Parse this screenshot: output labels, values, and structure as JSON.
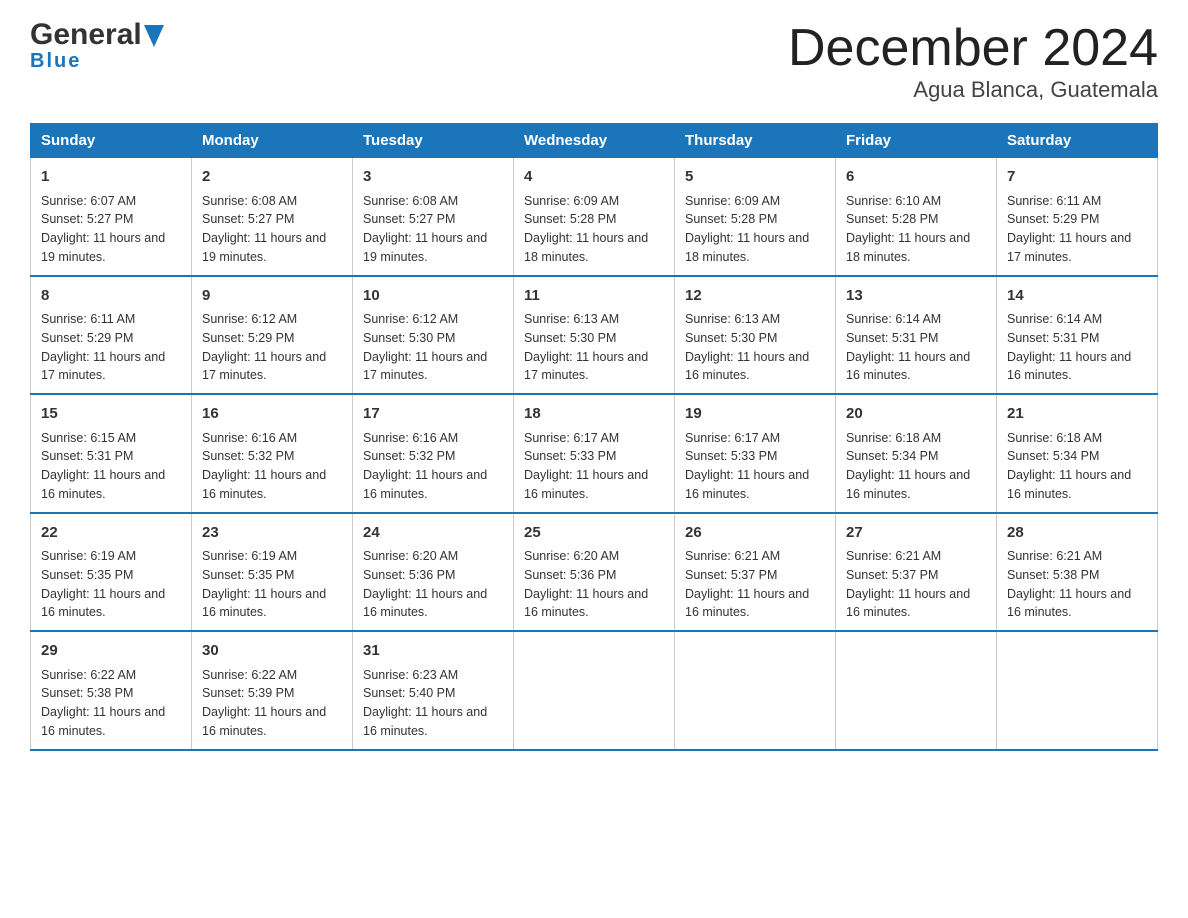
{
  "header": {
    "logo_line1": "General",
    "logo_line2": "Blue",
    "month": "December 2024",
    "location": "Agua Blanca, Guatemala"
  },
  "days_of_week": [
    "Sunday",
    "Monday",
    "Tuesday",
    "Wednesday",
    "Thursday",
    "Friday",
    "Saturday"
  ],
  "weeks": [
    [
      {
        "day": "1",
        "sunrise": "6:07 AM",
        "sunset": "5:27 PM",
        "daylight": "11 hours and 19 minutes."
      },
      {
        "day": "2",
        "sunrise": "6:08 AM",
        "sunset": "5:27 PM",
        "daylight": "11 hours and 19 minutes."
      },
      {
        "day": "3",
        "sunrise": "6:08 AM",
        "sunset": "5:27 PM",
        "daylight": "11 hours and 19 minutes."
      },
      {
        "day": "4",
        "sunrise": "6:09 AM",
        "sunset": "5:28 PM",
        "daylight": "11 hours and 18 minutes."
      },
      {
        "day": "5",
        "sunrise": "6:09 AM",
        "sunset": "5:28 PM",
        "daylight": "11 hours and 18 minutes."
      },
      {
        "day": "6",
        "sunrise": "6:10 AM",
        "sunset": "5:28 PM",
        "daylight": "11 hours and 18 minutes."
      },
      {
        "day": "7",
        "sunrise": "6:11 AM",
        "sunset": "5:29 PM",
        "daylight": "11 hours and 17 minutes."
      }
    ],
    [
      {
        "day": "8",
        "sunrise": "6:11 AM",
        "sunset": "5:29 PM",
        "daylight": "11 hours and 17 minutes."
      },
      {
        "day": "9",
        "sunrise": "6:12 AM",
        "sunset": "5:29 PM",
        "daylight": "11 hours and 17 minutes."
      },
      {
        "day": "10",
        "sunrise": "6:12 AM",
        "sunset": "5:30 PM",
        "daylight": "11 hours and 17 minutes."
      },
      {
        "day": "11",
        "sunrise": "6:13 AM",
        "sunset": "5:30 PM",
        "daylight": "11 hours and 17 minutes."
      },
      {
        "day": "12",
        "sunrise": "6:13 AM",
        "sunset": "5:30 PM",
        "daylight": "11 hours and 16 minutes."
      },
      {
        "day": "13",
        "sunrise": "6:14 AM",
        "sunset": "5:31 PM",
        "daylight": "11 hours and 16 minutes."
      },
      {
        "day": "14",
        "sunrise": "6:14 AM",
        "sunset": "5:31 PM",
        "daylight": "11 hours and 16 minutes."
      }
    ],
    [
      {
        "day": "15",
        "sunrise": "6:15 AM",
        "sunset": "5:31 PM",
        "daylight": "11 hours and 16 minutes."
      },
      {
        "day": "16",
        "sunrise": "6:16 AM",
        "sunset": "5:32 PM",
        "daylight": "11 hours and 16 minutes."
      },
      {
        "day": "17",
        "sunrise": "6:16 AM",
        "sunset": "5:32 PM",
        "daylight": "11 hours and 16 minutes."
      },
      {
        "day": "18",
        "sunrise": "6:17 AM",
        "sunset": "5:33 PM",
        "daylight": "11 hours and 16 minutes."
      },
      {
        "day": "19",
        "sunrise": "6:17 AM",
        "sunset": "5:33 PM",
        "daylight": "11 hours and 16 minutes."
      },
      {
        "day": "20",
        "sunrise": "6:18 AM",
        "sunset": "5:34 PM",
        "daylight": "11 hours and 16 minutes."
      },
      {
        "day": "21",
        "sunrise": "6:18 AM",
        "sunset": "5:34 PM",
        "daylight": "11 hours and 16 minutes."
      }
    ],
    [
      {
        "day": "22",
        "sunrise": "6:19 AM",
        "sunset": "5:35 PM",
        "daylight": "11 hours and 16 minutes."
      },
      {
        "day": "23",
        "sunrise": "6:19 AM",
        "sunset": "5:35 PM",
        "daylight": "11 hours and 16 minutes."
      },
      {
        "day": "24",
        "sunrise": "6:20 AM",
        "sunset": "5:36 PM",
        "daylight": "11 hours and 16 minutes."
      },
      {
        "day": "25",
        "sunrise": "6:20 AM",
        "sunset": "5:36 PM",
        "daylight": "11 hours and 16 minutes."
      },
      {
        "day": "26",
        "sunrise": "6:21 AM",
        "sunset": "5:37 PM",
        "daylight": "11 hours and 16 minutes."
      },
      {
        "day": "27",
        "sunrise": "6:21 AM",
        "sunset": "5:37 PM",
        "daylight": "11 hours and 16 minutes."
      },
      {
        "day": "28",
        "sunrise": "6:21 AM",
        "sunset": "5:38 PM",
        "daylight": "11 hours and 16 minutes."
      }
    ],
    [
      {
        "day": "29",
        "sunrise": "6:22 AM",
        "sunset": "5:38 PM",
        "daylight": "11 hours and 16 minutes."
      },
      {
        "day": "30",
        "sunrise": "6:22 AM",
        "sunset": "5:39 PM",
        "daylight": "11 hours and 16 minutes."
      },
      {
        "day": "31",
        "sunrise": "6:23 AM",
        "sunset": "5:40 PM",
        "daylight": "11 hours and 16 minutes."
      },
      null,
      null,
      null,
      null
    ]
  ],
  "colors": {
    "header_bg": "#1a75bb",
    "header_text": "#ffffff",
    "border": "#1a75bb",
    "text": "#333333"
  }
}
